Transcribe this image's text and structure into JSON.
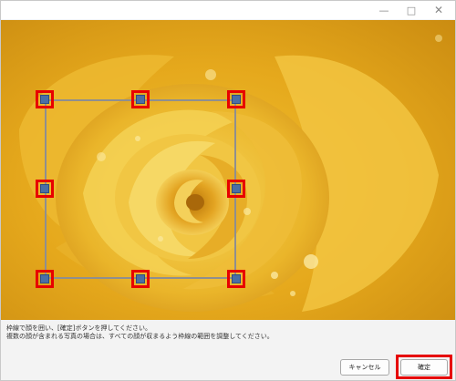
{
  "window": {
    "minimize_icon": "minimize-icon",
    "maximize_icon": "maximize-icon",
    "close_icon": "close-icon"
  },
  "photo": {
    "subject": "rose-photo"
  },
  "selection": {
    "frame_color": "#8f8f8f",
    "handle_highlight_color": "#e80000",
    "handles": [
      "top-left",
      "top-center",
      "top-right",
      "middle-left",
      "middle-right",
      "bottom-left",
      "bottom-center",
      "bottom-right"
    ]
  },
  "instructions": {
    "line1": "枠線で顔を囲い、[確定]ボタンを押してください。",
    "line2": "複数の顔が含まれる写真の場合は、すべての顔が収まるよう枠線の範囲を調整してください。"
  },
  "buttons": {
    "cancel": "キャンセル",
    "confirm": "確定"
  },
  "colors": {
    "accent_highlight": "#e60000",
    "dialog_bg": "#f3f3f3"
  }
}
